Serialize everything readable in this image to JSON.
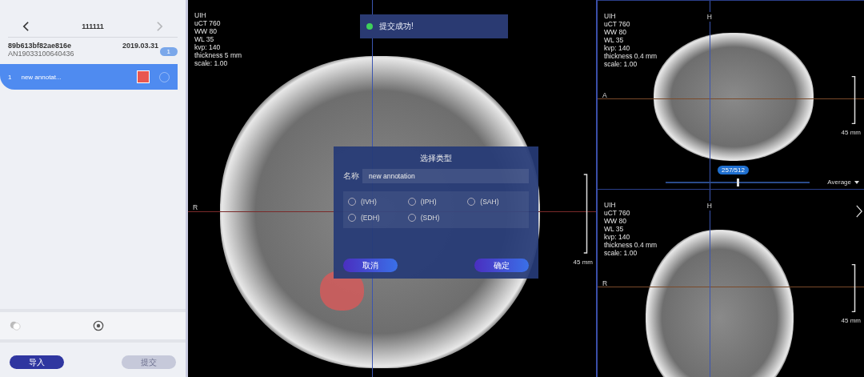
{
  "sidebar": {
    "title": "111111",
    "next_disabled": true,
    "study": {
      "id": "89b613bf82ae816e",
      "date": "2019.03.31",
      "accession": "AN19033100640436",
      "count": "1"
    },
    "annotations": [
      {
        "index": "1",
        "name": "new annotat...",
        "color": "#e8574f",
        "selected": true
      }
    ],
    "buttons": [
      {
        "label": "导入",
        "disabled": false
      },
      {
        "label": "提交",
        "disabled": true
      }
    ]
  },
  "viewports": [
    {
      "kind": "axial",
      "info": [
        "UIH",
        "uCT 760",
        "WW 80",
        "WL 35",
        "kvp: 140",
        "thickness 5 mm",
        "scale: 1.00"
      ],
      "orientation_left": "R",
      "scale": "45 mm"
    },
    {
      "kind": "sagittal",
      "info": [
        "UIH",
        "uCT 760",
        "WW 80",
        "WL 35",
        "kvp: 140",
        "thickness 0.4 mm",
        "scale: 1.00"
      ],
      "orientation_top": "H",
      "orientation_left": "A",
      "scale": "45 mm",
      "slice": "257/512",
      "slider": {
        "level": 0.5
      },
      "projection": "Average"
    },
    {
      "kind": "coronal",
      "info": [
        "UIH",
        "uCT 760",
        "WW 80",
        "WL 35",
        "kvp: 140",
        "thickness 0.4 mm",
        "scale: 1.00"
      ],
      "orientation_top": "H",
      "orientation_left": "R",
      "scale": "45 mm"
    }
  ],
  "toast": {
    "text": "提交成功!",
    "success": true
  },
  "dialog": {
    "title": "选择类型",
    "name_label": "名称",
    "name_value": "new annotation",
    "options": [
      {
        "label": "(IVH)",
        "selected": false
      },
      {
        "label": "(IPH)",
        "selected": false
      },
      {
        "label": "(SAH)",
        "selected": false
      },
      {
        "label": "(EDH)",
        "selected": false
      },
      {
        "label": "(SDH)",
        "selected": false
      }
    ],
    "buttons": [
      "取消",
      "确定"
    ]
  }
}
